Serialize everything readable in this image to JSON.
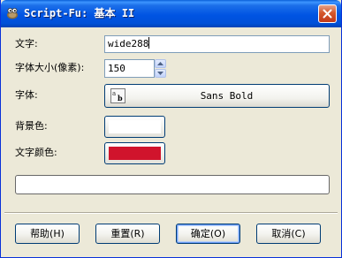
{
  "window": {
    "title": "Script-Fu: 基本 II"
  },
  "fields": {
    "text": {
      "label": "文字:",
      "value": "wide288"
    },
    "font_size": {
      "label": "字体大小(像素):",
      "value": "150"
    },
    "font": {
      "label": "字体:",
      "value": "Sans Bold",
      "icon_text": "ab"
    },
    "background_color": {
      "label": "背景色:",
      "color": "#ffffff"
    },
    "text_color": {
      "label": "文字颜色:",
      "color": "#d0142c"
    }
  },
  "progress": {
    "value": 0
  },
  "buttons": {
    "help": "帮助(H)",
    "reset": "重置(R)",
    "ok": "确定(O)",
    "cancel": "取消(C)"
  },
  "colors": {
    "titlebar": "#0054e3",
    "dialog": "#ece9d8"
  }
}
